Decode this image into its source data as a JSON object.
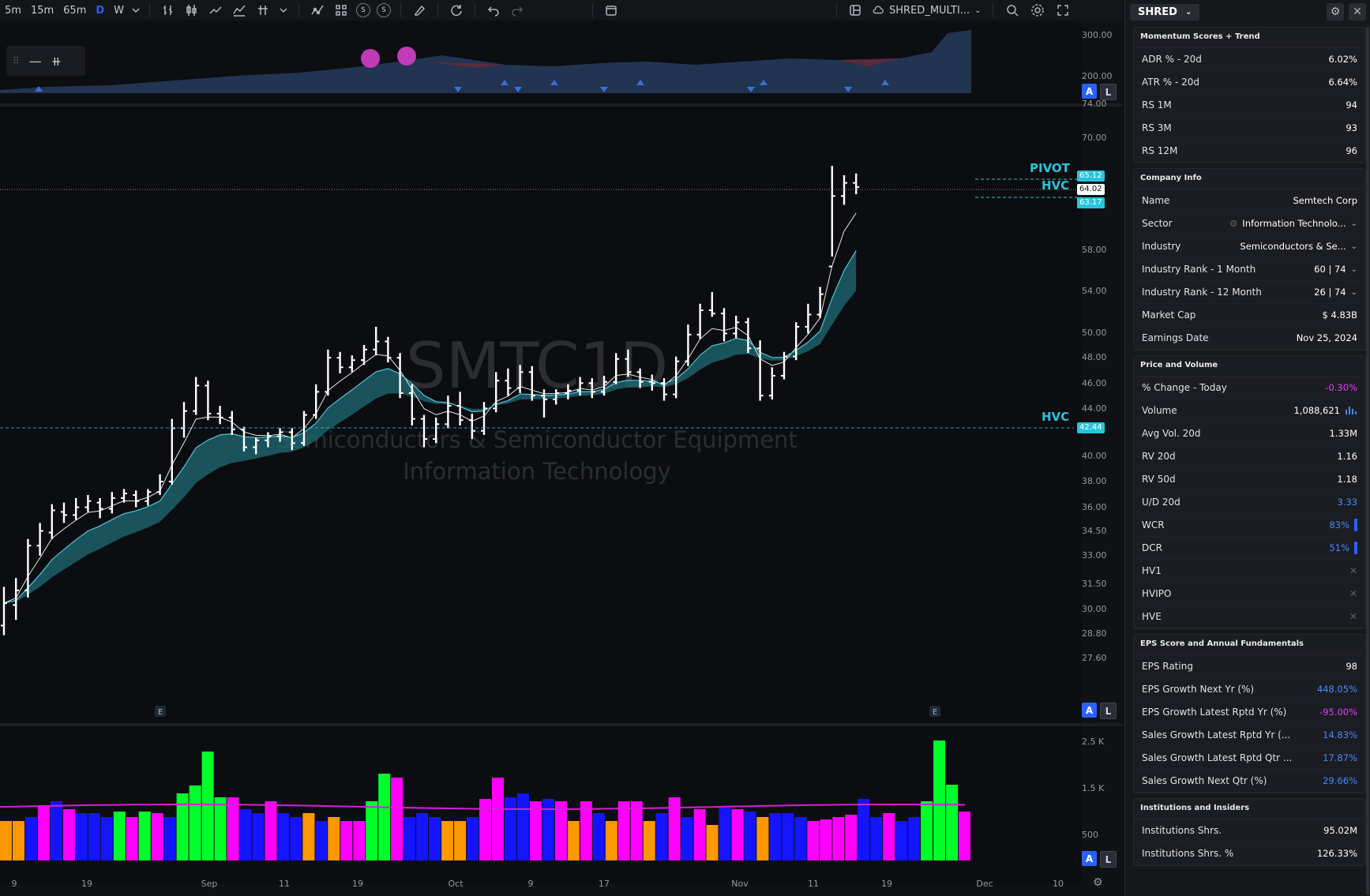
{
  "toolbar": {
    "intervals": [
      "5m",
      "15m",
      "65m",
      "D",
      "W"
    ],
    "active_interval": "D",
    "layout_name": "SHRED_MULTI..."
  },
  "symbol": "SHRED",
  "watermark": {
    "ticker": "SMTC1D",
    "line1": "Semiconductors & Semiconductor Equipment",
    "line2": "Information Technology"
  },
  "price_axis": {
    "ticks": [
      "74.00",
      "70.00",
      "58.00",
      "54.00",
      "50.00",
      "48.00",
      "46.00",
      "44.00",
      "40.00",
      "38.00",
      "36.00",
      "34.50",
      "33.00",
      "31.50",
      "30.00",
      "28.80",
      "27.60"
    ]
  },
  "top_pane_axis": [
    "300.00",
    "200.00"
  ],
  "volume_axis": [
    "2.5 K",
    "1.5 K",
    "500"
  ],
  "time_axis": [
    "9",
    "19",
    "Sep",
    "11",
    "19",
    "Oct",
    "9",
    "17",
    "Nov",
    "11",
    "19",
    "Dec",
    "10"
  ],
  "levels": {
    "pivot_label": "PIVOT",
    "hvc_label": "HVC",
    "hvc2_label": "HVC",
    "pivot_price": "65.12",
    "last_price": "64.02",
    "hvc_price": "63.17",
    "hvc2_price": "42.44"
  },
  "markers": {
    "earnings": "E",
    "btn_a": "A",
    "btn_l": "L"
  },
  "chart_data": {
    "type": "candlestick",
    "bars": [
      [
        29.1,
        31.2,
        28.6,
        30.3
      ],
      [
        30.2,
        31.7,
        29.4,
        31.0
      ],
      [
        31.0,
        34.0,
        30.6,
        33.6
      ],
      [
        33.6,
        35.0,
        33.0,
        34.5
      ],
      [
        34.4,
        36.2,
        34.0,
        35.8
      ],
      [
        35.7,
        36.3,
        35.0,
        35.5
      ],
      [
        35.5,
        36.6,
        35.2,
        36.0
      ],
      [
        36.0,
        36.8,
        35.7,
        36.4
      ],
      [
        36.3,
        36.6,
        35.3,
        35.9
      ],
      [
        35.9,
        37.0,
        35.6,
        36.6
      ],
      [
        36.6,
        37.2,
        36.3,
        36.9
      ],
      [
        36.8,
        37.1,
        36.0,
        36.4
      ],
      [
        36.4,
        37.2,
        36.1,
        37.0
      ],
      [
        37.0,
        38.2,
        36.8,
        37.7
      ],
      [
        37.7,
        42.2,
        37.5,
        41.5
      ],
      [
        41.5,
        43.5,
        40.8,
        42.8
      ],
      [
        42.8,
        45.5,
        42.5,
        44.8
      ],
      [
        44.8,
        45.2,
        42.1,
        42.6
      ],
      [
        42.6,
        43.2,
        41.8,
        42.3
      ],
      [
        42.3,
        42.8,
        41.0,
        41.4
      ],
      [
        41.4,
        41.6,
        39.8,
        40.1
      ],
      [
        40.1,
        40.8,
        39.6,
        40.6
      ],
      [
        40.6,
        41.2,
        40.1,
        40.9
      ],
      [
        40.9,
        41.5,
        40.5,
        41.2
      ],
      [
        41.2,
        41.5,
        39.9,
        40.4
      ],
      [
        40.4,
        42.8,
        40.2,
        42.5
      ],
      [
        42.5,
        44.9,
        42.2,
        44.3
      ],
      [
        44.3,
        47.8,
        44.0,
        47.1
      ],
      [
        47.1,
        47.6,
        45.8,
        46.3
      ],
      [
        46.3,
        47.3,
        45.9,
        46.9
      ],
      [
        46.9,
        48.2,
        46.5,
        47.8
      ],
      [
        47.8,
        49.8,
        47.3,
        48.5
      ],
      [
        48.5,
        48.9,
        46.7,
        47.1
      ],
      [
        47.1,
        47.5,
        43.8,
        44.2
      ],
      [
        44.2,
        44.9,
        41.7,
        42.2
      ],
      [
        42.2,
        42.5,
        40.1,
        40.7
      ],
      [
        40.7,
        42.3,
        40.4,
        41.8
      ],
      [
        41.8,
        44.0,
        41.5,
        43.2
      ],
      [
        43.2,
        44.3,
        41.7,
        42.1
      ],
      [
        42.1,
        42.6,
        40.7,
        41.3
      ],
      [
        41.3,
        43.5,
        41.0,
        43.0
      ],
      [
        43.0,
        45.9,
        42.7,
        45.2
      ],
      [
        45.2,
        46.2,
        44.0,
        44.6
      ],
      [
        44.6,
        46.5,
        44.2,
        45.9
      ],
      [
        45.9,
        46.4,
        43.6,
        44.0
      ],
      [
        44.0,
        44.5,
        42.3,
        43.7
      ],
      [
        43.7,
        44.5,
        43.3,
        44.2
      ],
      [
        44.2,
        44.9,
        43.7,
        44.4
      ],
      [
        44.4,
        45.5,
        44.0,
        45.0
      ],
      [
        45.0,
        45.4,
        43.8,
        44.3
      ],
      [
        44.3,
        45.6,
        44.0,
        45.1
      ],
      [
        45.1,
        47.5,
        44.9,
        47.0
      ],
      [
        47.0,
        47.8,
        45.5,
        45.9
      ],
      [
        45.9,
        46.2,
        44.6,
        45.1
      ],
      [
        45.1,
        45.7,
        44.4,
        45.0
      ],
      [
        45.0,
        45.4,
        43.6,
        44.1
      ],
      [
        44.1,
        47.2,
        43.8,
        46.8
      ],
      [
        46.8,
        50.0,
        46.4,
        49.1
      ],
      [
        49.1,
        51.9,
        48.7,
        51.3
      ],
      [
        51.3,
        53.0,
        50.7,
        51.0
      ],
      [
        51.0,
        51.5,
        48.5,
        49.2
      ],
      [
        49.2,
        50.8,
        48.8,
        50.2
      ],
      [
        50.2,
        50.6,
        47.5,
        47.9
      ],
      [
        47.9,
        48.6,
        43.6,
        44.0
      ],
      [
        44.0,
        46.3,
        43.7,
        45.6
      ],
      [
        45.6,
        47.6,
        45.3,
        47.2
      ],
      [
        47.2,
        50.2,
        46.9,
        49.8
      ],
      [
        49.8,
        51.9,
        49.2,
        50.9
      ],
      [
        50.9,
        53.5,
        50.6,
        52.8
      ],
      [
        55.5,
        66.5,
        56.5,
        63.0
      ],
      [
        63.0,
        65.4,
        62.0,
        64.5
      ],
      [
        64.5,
        65.6,
        63.2,
        64.02
      ]
    ]
  },
  "panel": {
    "sections": [
      {
        "title": "Momentum Scores + Trend",
        "rows": [
          {
            "k": "ADR % - 20d",
            "v": "6.02%"
          },
          {
            "k": "ATR % - 20d",
            "v": "6.64%"
          },
          {
            "k": "RS 1M",
            "v": "94"
          },
          {
            "k": "RS 3M",
            "v": "93"
          },
          {
            "k": "RS 12M",
            "v": "96"
          }
        ]
      },
      {
        "title": "Company Info",
        "rows": [
          {
            "k": "Name",
            "v": "Semtech Corp"
          },
          {
            "k": "Sector",
            "v": "Information Technolo...",
            "chev": true,
            "icon": true
          },
          {
            "k": "Industry",
            "v": "Semiconductors & Se...",
            "chev": true
          },
          {
            "k": "Industry Rank - 1 Month",
            "v": "60 | 74",
            "chev": true
          },
          {
            "k": "Industry Rank - 12 Month",
            "v": "26 | 74",
            "chev": true
          },
          {
            "k": "Market Cap",
            "v": "$ 4.83B"
          },
          {
            "k": "Earnings Date",
            "v": "Nov 25, 2024"
          }
        ]
      },
      {
        "title": "Price and Volume",
        "rows": [
          {
            "k": "% Change - Today",
            "v": "-0.30%",
            "cls": "pink"
          },
          {
            "k": "Volume",
            "v": "1,088,621",
            "bars": true
          },
          {
            "k": "Avg Vol. 20d",
            "v": "1.33M"
          },
          {
            "k": "RV 20d",
            "v": "1.16"
          },
          {
            "k": "RV 50d",
            "v": "1.18"
          },
          {
            "k": "U/D 20d",
            "v": "3.33",
            "cls": "blue"
          },
          {
            "k": "WCR",
            "v": "83%",
            "cls": "blue",
            "mini": true
          },
          {
            "k": "DCR",
            "v": "51%",
            "cls": "blue",
            "mini": true
          },
          {
            "k": "HV1",
            "v": "✕",
            "cls": "x"
          },
          {
            "k": "HVIPO",
            "v": "✕",
            "cls": "x"
          },
          {
            "k": "HVE",
            "v": "✕",
            "cls": "x"
          }
        ]
      },
      {
        "title": "EPS Score and Annual Fundamentals",
        "rows": [
          {
            "k": "EPS Rating",
            "v": "98"
          },
          {
            "k": "EPS Growth Next Yr (%)",
            "v": "448.05%",
            "cls": "blue"
          },
          {
            "k": "EPS Growth Latest Rptd Yr (%)",
            "v": "-95.00%",
            "cls": "pink"
          },
          {
            "k": "Sales Growth Latest Rptd Yr (...",
            "v": "14.83%",
            "cls": "blue"
          },
          {
            "k": "Sales Growth Latest Rptd Qtr ...",
            "v": "17.87%",
            "cls": "blue"
          },
          {
            "k": "Sales Growth Next Qtr (%)",
            "v": "29.66%",
            "cls": "blue"
          }
        ]
      },
      {
        "title": "Institutions and Insiders",
        "rows": [
          {
            "k": "Institutions Shrs.",
            "v": "95.02M"
          },
          {
            "k": "Institutions Shrs. %",
            "v": "126.33%"
          }
        ]
      }
    ]
  }
}
